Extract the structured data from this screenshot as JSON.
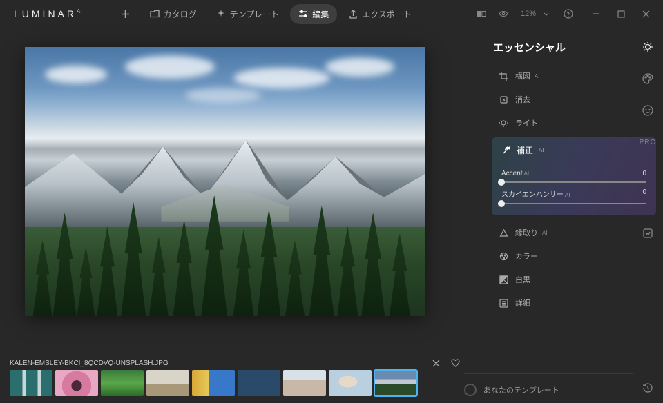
{
  "logo": {
    "main": "LUMINAR",
    "suffix": "AI"
  },
  "topnav": {
    "add": "",
    "catalog": "カタログ",
    "templates": "テンプレート",
    "edit": "編集",
    "export": "エクスポート"
  },
  "toputils": {
    "zoom": "12%"
  },
  "panel": {
    "title": "エッセンシャル",
    "tools": {
      "composition": "構図",
      "erase": "消去",
      "light": "ライト",
      "enhance": "補正",
      "structure": "縁取り",
      "color": "カラー",
      "blackwhite": "白黒",
      "details": "詳細"
    },
    "enhance_panel": {
      "accent": {
        "label": "Accent",
        "value": "0"
      },
      "sky": {
        "label": "スカイエンハンサー",
        "value": "0"
      }
    }
  },
  "vrail": {
    "pro": "PRO"
  },
  "filmstrip": {
    "filename": "KALEN-EMSLEY-BKCI_8QCDVQ-UNSPLASH.JPG"
  },
  "template_footer": "あなたのテンプレート",
  "ai_badge": "AI"
}
